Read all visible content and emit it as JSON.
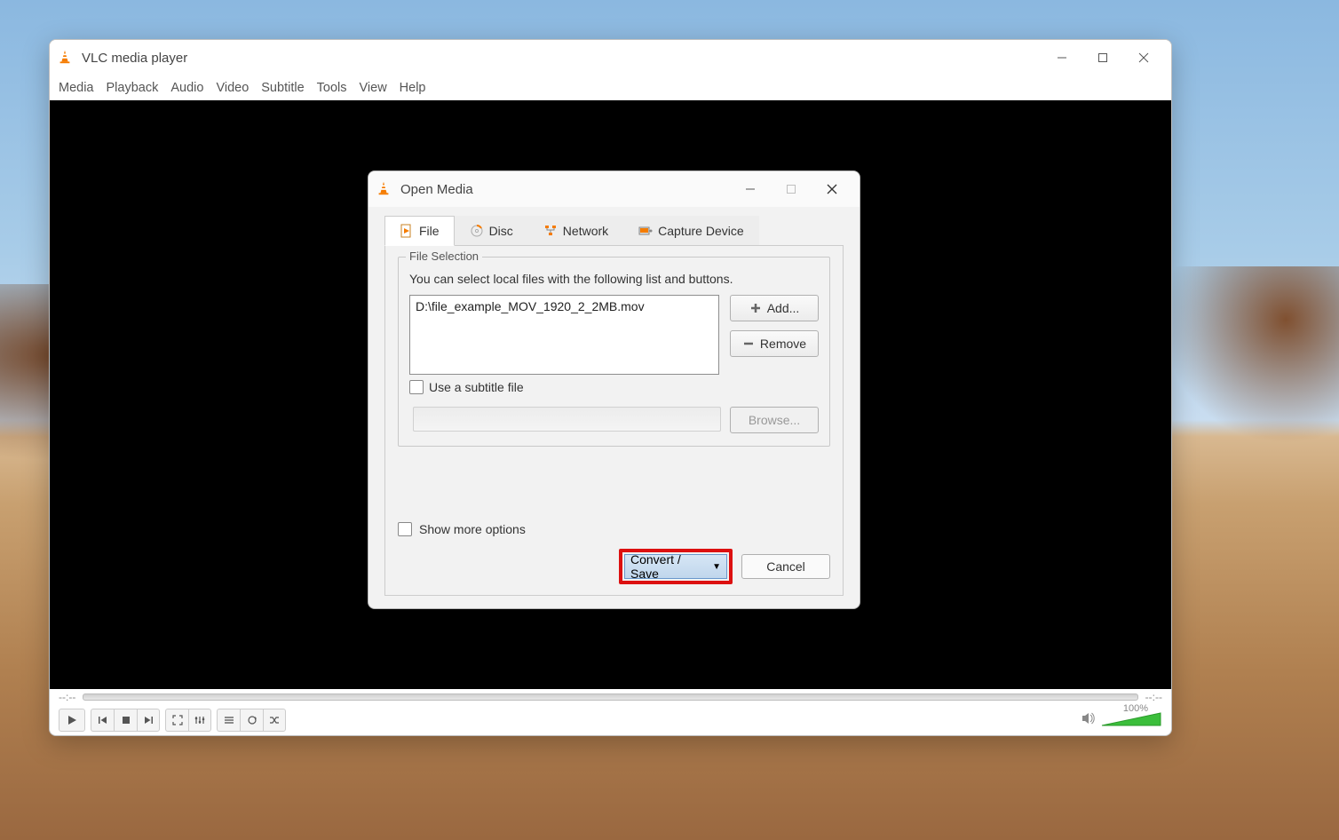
{
  "main_window": {
    "title": "VLC media player",
    "menus": [
      "Media",
      "Playback",
      "Audio",
      "Video",
      "Subtitle",
      "Tools",
      "View",
      "Help"
    ],
    "time_left": "--:--",
    "time_right": "--:--",
    "volume_pct": "100%"
  },
  "dialog": {
    "title": "Open Media",
    "tabs": {
      "file": "File",
      "disc": "Disc",
      "network": "Network",
      "capture": "Capture Device"
    },
    "file_selection_legend": "File Selection",
    "file_help": "You can select local files with the following list and buttons.",
    "files": [
      "D:\\file_example_MOV_1920_2_2MB.mov"
    ],
    "add_label": "Add...",
    "remove_label": "Remove",
    "subtitle_check": "Use a subtitle file",
    "browse_label": "Browse...",
    "more_options": "Show more options",
    "convert_label": "Convert / Save",
    "cancel_label": "Cancel"
  }
}
